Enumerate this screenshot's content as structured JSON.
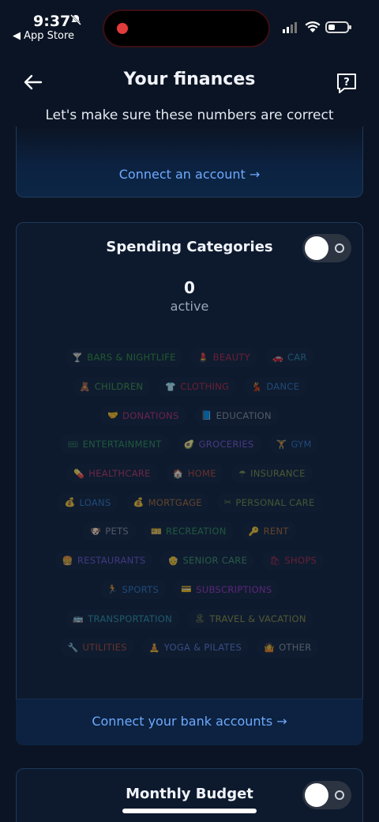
{
  "status": {
    "time": "9:37",
    "back_app": "◀ App Store"
  },
  "header": {
    "title": "Your finances",
    "subtitle": "Let's make sure these numbers are correct"
  },
  "connect_account": {
    "label": "Connect an account →"
  },
  "spending": {
    "title": "Spending Categories",
    "count": "0",
    "count_label": "active",
    "footer_link": "Connect your bank accounts →",
    "categories": [
      [
        {
          "icon": "🍸",
          "label": "BARS & NIGHTLIFE",
          "color": "#2e8b2e"
        },
        {
          "icon": "💄",
          "label": "BEAUTY",
          "color": "#b3243d"
        },
        {
          "icon": "🚗",
          "label": "CAR",
          "color": "#2b7f9e"
        }
      ],
      [
        {
          "icon": "🧸",
          "label": "CHILDREN",
          "color": "#3e8f3e"
        },
        {
          "icon": "👕",
          "label": "CLOTHING",
          "color": "#b3243d"
        },
        {
          "icon": "💃",
          "label": "DANCE",
          "color": "#2e6fb5"
        }
      ],
      [
        {
          "icon": "🤝",
          "label": "DONATIONS",
          "color": "#b82a6b"
        },
        {
          "icon": "📘",
          "label": "EDUCATION",
          "color": "#8a8f96"
        }
      ],
      [
        {
          "icon": "🎟",
          "label": "ENTERTAINMENT",
          "color": "#2e8b4e"
        },
        {
          "icon": "🥑",
          "label": "GROCERIES",
          "color": "#7a52c7"
        },
        {
          "icon": "🏋",
          "label": "GYM",
          "color": "#2e6fb5"
        }
      ],
      [
        {
          "icon": "💊",
          "label": "HEALTHCARE",
          "color": "#b8305a"
        },
        {
          "icon": "🏠",
          "label": "HOME",
          "color": "#b0452b"
        },
        {
          "icon": "☂",
          "label": "INSURANCE",
          "color": "#7d8a3a"
        }
      ],
      [
        {
          "icon": "💰",
          "label": "LOANS",
          "color": "#2e6fb5"
        },
        {
          "icon": "💰",
          "label": "MORTGAGE",
          "color": "#a8652b"
        },
        {
          "icon": "✂",
          "label": "PERSONAL CARE",
          "color": "#6b8a3a"
        }
      ],
      [
        {
          "icon": "🐶",
          "label": "PETS",
          "color": "#8a8f96"
        },
        {
          "icon": "🎫",
          "label": "RECREATION",
          "color": "#2e8b4e"
        },
        {
          "icon": "🔑",
          "label": "RENT",
          "color": "#a8652b"
        }
      ],
      [
        {
          "icon": "🍔",
          "label": "RESTAURANTS",
          "color": "#6b52c7"
        },
        {
          "icon": "👴",
          "label": "SENIOR CARE",
          "color": "#3e8f5e"
        },
        {
          "icon": "🛍",
          "label": "SHOPS",
          "color": "#b3243d"
        }
      ],
      [
        {
          "icon": "🏃",
          "label": "SPORTS",
          "color": "#2e6fb5"
        },
        {
          "icon": "💳",
          "label": "SUBSCRIPTIONS",
          "color": "#9b2fb5"
        }
      ],
      [
        {
          "icon": "🚌",
          "label": "TRANSPORTATION",
          "color": "#2b8f9e"
        },
        {
          "icon": "🏝",
          "label": "TRAVEL & VACATION",
          "color": "#8a8a3a"
        }
      ],
      [
        {
          "icon": "🔧",
          "label": "UTILITIES",
          "color": "#b0452b"
        },
        {
          "icon": "🧘",
          "label": "YOGA & PILATES",
          "color": "#5a74c7"
        },
        {
          "icon": "🤷",
          "label": "OTHER",
          "color": "#8a8f96"
        }
      ]
    ]
  },
  "budget": {
    "title": "Monthly Budget"
  },
  "colors": {
    "background": "#0b1424",
    "accent_link": "#6ea9ff",
    "card_border": "#1f3a5c"
  }
}
